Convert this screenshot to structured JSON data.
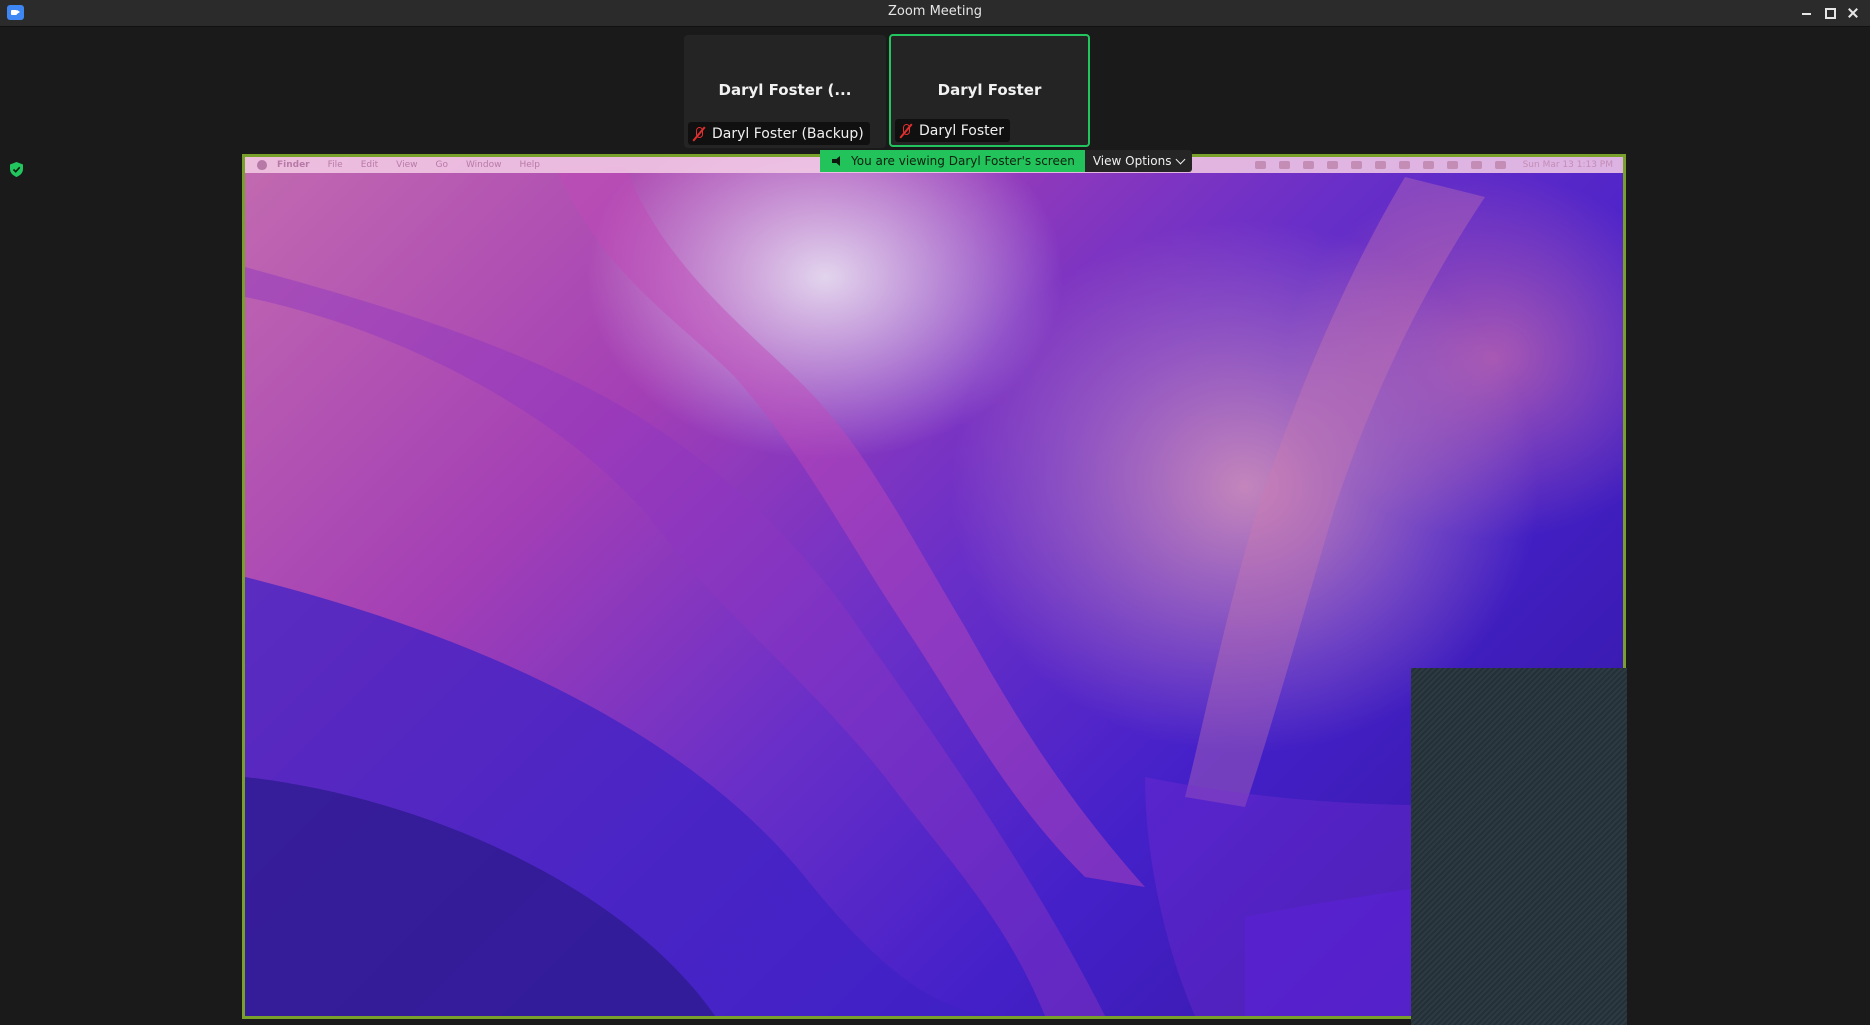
{
  "window": {
    "title": "Zoom Meeting"
  },
  "participants": [
    {
      "tile_name": "Daryl Foster (...",
      "label": "Daryl Foster (Backup)",
      "muted": true,
      "active_speaker": false
    },
    {
      "tile_name": "Daryl Foster",
      "label": "Daryl Foster",
      "muted": true,
      "active_speaker": true
    }
  ],
  "share_banner": {
    "text": "You are viewing Daryl Foster's screen",
    "view_options_label": "View Options"
  },
  "shared_screen": {
    "menubar": [
      "Finder",
      "File",
      "Edit",
      "View",
      "Go",
      "Window",
      "Help"
    ],
    "clock": "Sun Mar 13  1:13 PM"
  },
  "icons": {
    "app": "zoom-camera-icon",
    "security": "shield-check-icon",
    "mute": "mic-off-icon",
    "speaker": "speaker-icon",
    "dropdown": "chevron-down-icon"
  },
  "colors": {
    "accent_green": "#21c35a",
    "share_border": "#7aa02c",
    "muted_red": "#e02f2f",
    "background": "#1a1a1a"
  }
}
